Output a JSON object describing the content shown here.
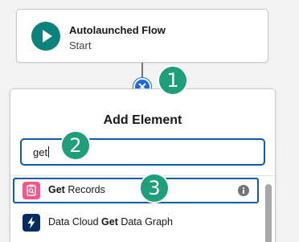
{
  "start_node": {
    "title": "Autolaunched Flow",
    "subtitle": "Start",
    "icon": "play-icon",
    "icon_color": "#0b827c"
  },
  "connector": {
    "close_icon": "close-icon",
    "close_color": "#1b6ae3"
  },
  "annotations": {
    "step_1": "1",
    "step_2": "2",
    "step_3": "3",
    "badge_color": "#1e9e79"
  },
  "add_element": {
    "title": "Add Element",
    "search": {
      "value": "get"
    },
    "results": [
      {
        "prefix": "",
        "match": "Get",
        "suffix": " Records",
        "icon": "get-records-icon",
        "icon_color": "#ff538a",
        "has_info": true,
        "selected": true
      },
      {
        "prefix": "Data Cloud ",
        "match": "Get",
        "suffix": " Data Graph",
        "icon": "lightning-icon",
        "icon_color": "#032d60",
        "has_info": false,
        "selected": false
      }
    ]
  },
  "colors": {
    "focus_border": "#0b5cab",
    "canvas": "#f3f3f3"
  }
}
